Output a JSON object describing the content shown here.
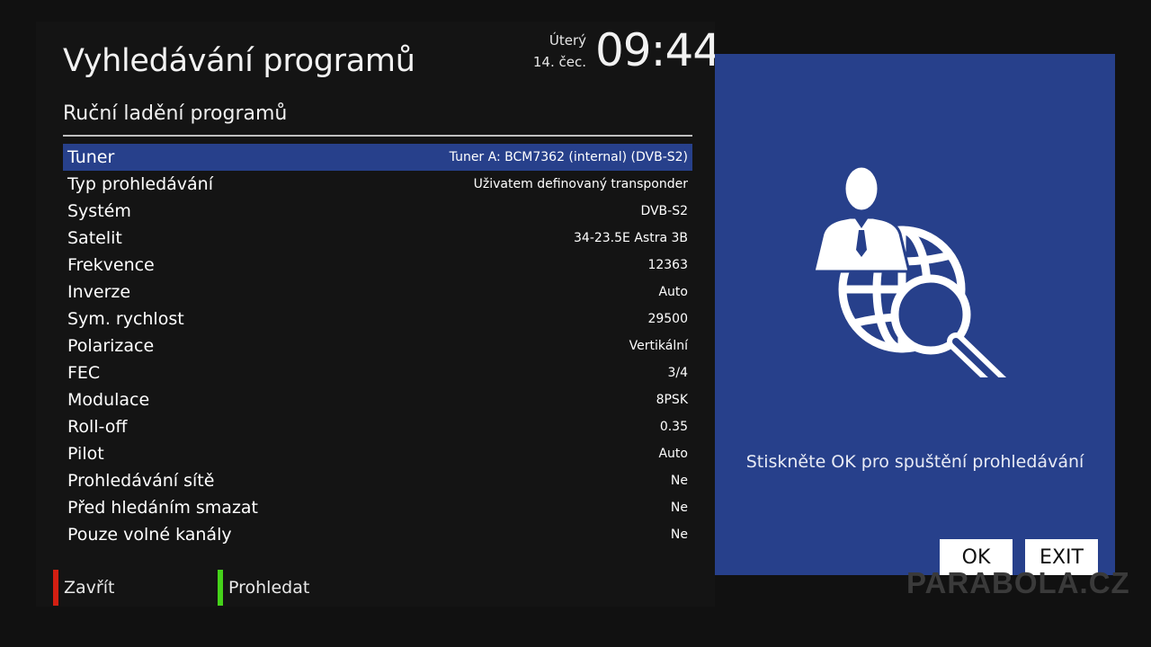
{
  "header": {
    "title": "Vyhledávání programů",
    "subtitle": "Ruční ladění programů",
    "clock": {
      "day": "Úterý",
      "date": "14. čec.",
      "time": "09:44"
    }
  },
  "settings": [
    {
      "label": "Tuner",
      "value": "Tuner A: BCM7362 (internal) (DVB-S2)",
      "selected": true
    },
    {
      "label": "Typ prohledávání",
      "value": "Uživatem definovaný transponder"
    },
    {
      "label": "Systém",
      "value": "DVB-S2"
    },
    {
      "label": "Satelit",
      "value": "34-23.5E Astra 3B"
    },
    {
      "label": "Frekvence",
      "value": "12363"
    },
    {
      "label": "Inverze",
      "value": "Auto"
    },
    {
      "label": "Sym. rychlost",
      "value": "29500"
    },
    {
      "label": "Polarizace",
      "value": "Vertikální"
    },
    {
      "label": "FEC",
      "value": "3/4"
    },
    {
      "label": "Modulace",
      "value": "8PSK"
    },
    {
      "label": "Roll-off",
      "value": "0.35"
    },
    {
      "label": "Pilot",
      "value": "Auto"
    },
    {
      "label": "Prohledávání sítě",
      "value": "Ne"
    },
    {
      "label": "Před hledáním smazat",
      "value": "Ne"
    },
    {
      "label": "Pouze volné kanály",
      "value": "Ne"
    }
  ],
  "footer": {
    "red": {
      "label": "Zavřít",
      "color": "#d21f12"
    },
    "green": {
      "label": "Prohledat",
      "color": "#45d21a"
    }
  },
  "info_panel": {
    "icon": "user-globe-search-icon",
    "message": "Stiskněte OK pro spuštění prohledávání",
    "ok_label": "OK",
    "exit_label": "EXIT"
  },
  "watermark": "PARABOLA.CZ",
  "colors": {
    "selected_row": "#27408b",
    "panel": "#27408b",
    "background": "#111111"
  }
}
